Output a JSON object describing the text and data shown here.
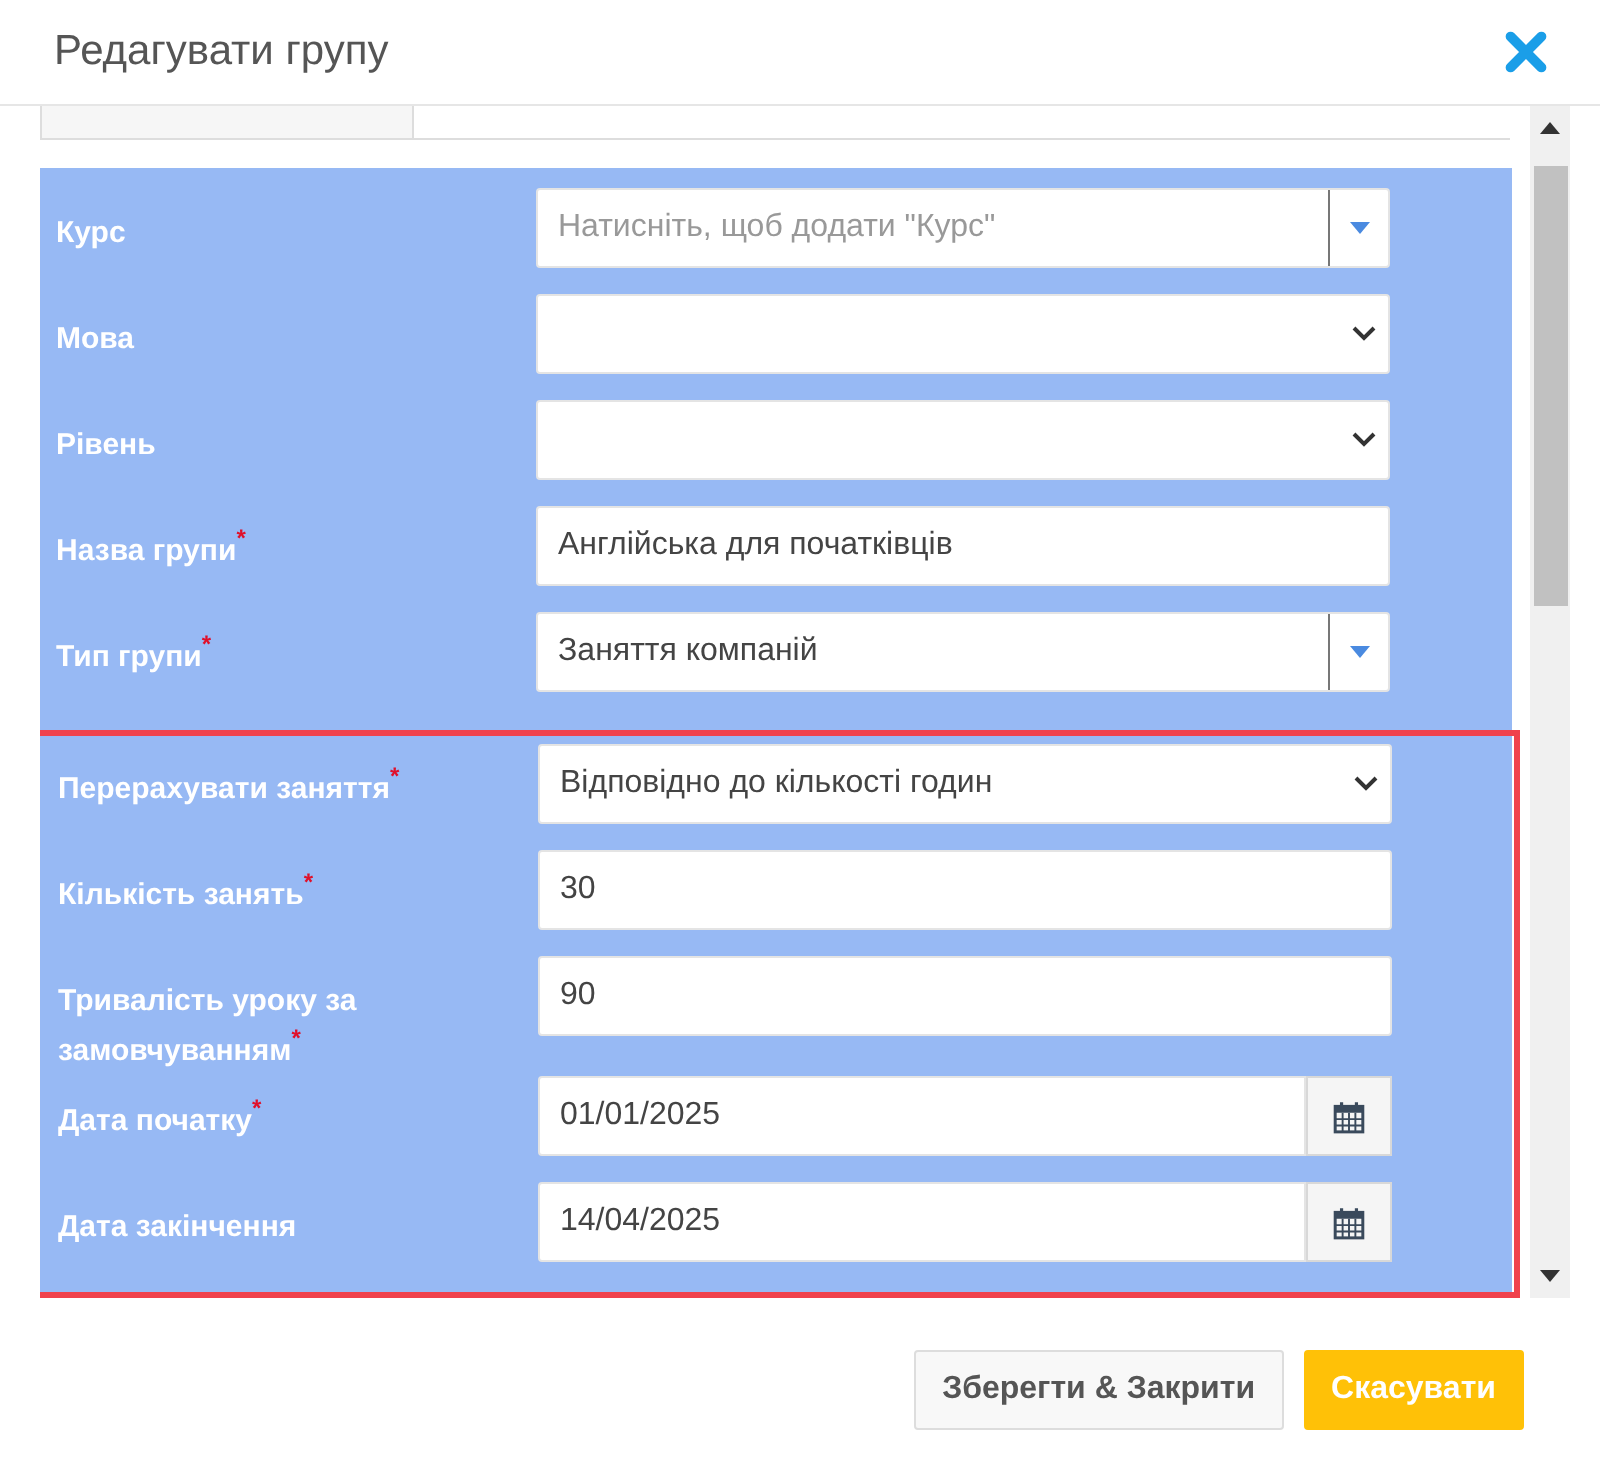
{
  "dialog": {
    "title": "Редагувати групу"
  },
  "sections": [
    {
      "highlighted": false,
      "fields": [
        {
          "kind": "combo",
          "label": "Курс",
          "placeholder": "Натисніть, щоб додати \"Курс\""
        },
        {
          "kind": "select",
          "label": "Мова"
        },
        {
          "kind": "select",
          "label": "Рівень"
        },
        {
          "kind": "text",
          "label": "Назва групи",
          "required_mark": "*",
          "value": "Англійська для початківців"
        },
        {
          "kind": "combo",
          "label": "Тип групи",
          "required_mark": "*",
          "value": "Заняття компаній"
        }
      ]
    },
    {
      "highlighted": true,
      "fields": [
        {
          "kind": "select",
          "label": "Перерахувати заняття",
          "required_mark": "*",
          "value": "Відповідно до кількості годин"
        },
        {
          "kind": "text",
          "label": "Кількість занять",
          "required_mark": "*",
          "value": "30"
        },
        {
          "kind": "text",
          "label": "Тривалість уроку за замовчуванням",
          "required_mark": "*",
          "value": "90"
        },
        {
          "kind": "date",
          "label": "Дата початку",
          "required_mark": "*",
          "value": "01/01/2025"
        },
        {
          "kind": "date",
          "label": "Дата закінчення",
          "value": "14/04/2025"
        }
      ]
    }
  ],
  "buttons": [
    {
      "kind": "default",
      "label": "Зберегти & Закрити"
    },
    {
      "kind": "primary",
      "label": "Скасувати"
    }
  ]
}
